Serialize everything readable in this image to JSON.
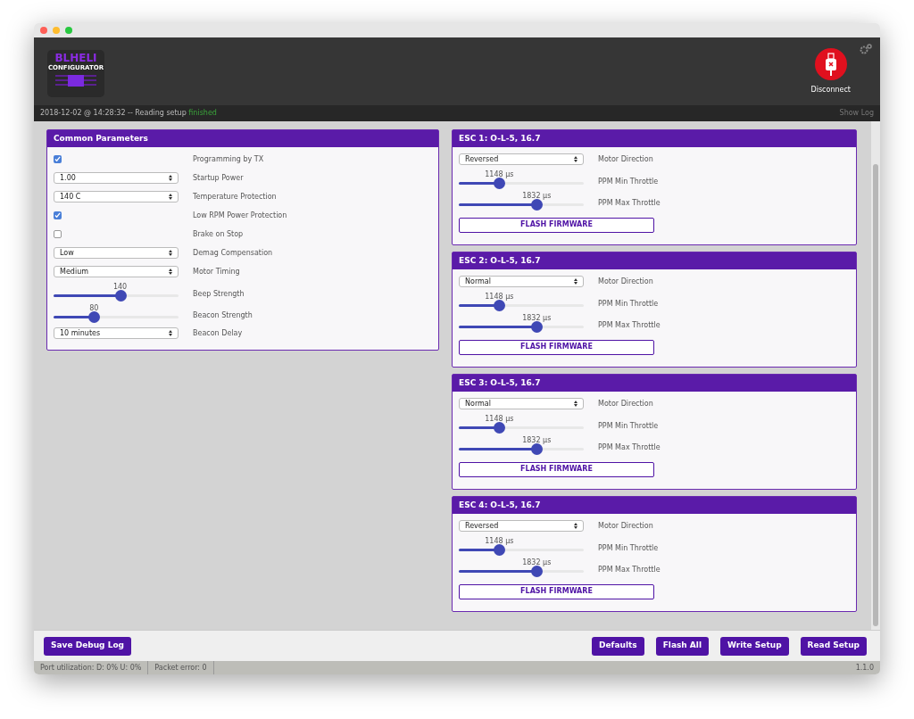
{
  "logo": {
    "line_1": "BLHELI",
    "line_2": "CONFIGURATOR"
  },
  "connection": {
    "label": "Disconnect"
  },
  "log_bar": {
    "message": "2018-12-02 @ 14:28:32 -- Reading setup",
    "status": "finished",
    "show_log": "Show Log"
  },
  "common": {
    "title": "Common Parameters",
    "rows": [
      {
        "kind": "checkbox",
        "label": "Programming by TX",
        "checked": true
      },
      {
        "kind": "select",
        "label": "Startup Power",
        "value": "1.00"
      },
      {
        "kind": "select",
        "label": "Temperature Protection",
        "value": "140 C"
      },
      {
        "kind": "checkbox",
        "label": "Low RPM Power Protection",
        "checked": true
      },
      {
        "kind": "checkbox",
        "label": "Brake on Stop",
        "checked": false
      },
      {
        "kind": "select",
        "label": "Demag Compensation",
        "value": "Low"
      },
      {
        "kind": "select",
        "label": "Motor Timing",
        "value": "Medium"
      },
      {
        "kind": "slider",
        "label": "Beep Strength",
        "reading": "140",
        "level": 0.54
      },
      {
        "kind": "slider",
        "label": "Beacon Strength",
        "reading": "80",
        "level": 0.31
      },
      {
        "kind": "select",
        "label": "Beacon Delay",
        "value": "10 minutes"
      }
    ]
  },
  "escs": [
    {
      "title": "ESC 1: O-L-5, 16.7",
      "rows": [
        {
          "kind": "select",
          "label": "Motor Direction",
          "value": "Reversed"
        },
        {
          "kind": "slider",
          "label": "PPM Min Throttle",
          "reading": "1148 µs",
          "level": 0.31
        },
        {
          "kind": "slider",
          "label": "PPM Max Throttle",
          "reading": "1832 µs",
          "level": 0.64
        }
      ],
      "button": "FLASH FIRMWARE"
    },
    {
      "title": "ESC 2: O-L-5, 16.7",
      "rows": [
        {
          "kind": "select",
          "label": "Motor Direction",
          "value": "Normal"
        },
        {
          "kind": "slider",
          "label": "PPM Min Throttle",
          "reading": "1148 µs",
          "level": 0.31
        },
        {
          "kind": "slider",
          "label": "PPM Max Throttle",
          "reading": "1832 µs",
          "level": 0.64
        }
      ],
      "button": "FLASH FIRMWARE"
    },
    {
      "title": "ESC 3: O-L-5, 16.7",
      "rows": [
        {
          "kind": "select",
          "label": "Motor Direction",
          "value": "Normal"
        },
        {
          "kind": "slider",
          "label": "PPM Min Throttle",
          "reading": "1148 µs",
          "level": 0.31
        },
        {
          "kind": "slider",
          "label": "PPM Max Throttle",
          "reading": "1832 µs",
          "level": 0.64
        }
      ],
      "button": "FLASH FIRMWARE"
    },
    {
      "title": "ESC 4: O-L-5, 16.7",
      "rows": [
        {
          "kind": "select",
          "label": "Motor Direction",
          "value": "Reversed"
        },
        {
          "kind": "slider",
          "label": "PPM Min Throttle",
          "reading": "1148 µs",
          "level": 0.31
        },
        {
          "kind": "slider",
          "label": "PPM Max Throttle",
          "reading": "1832 µs",
          "level": 0.64
        }
      ],
      "button": "FLASH FIRMWARE"
    }
  ],
  "footer": {
    "left_button": "Save Debug Log",
    "right_buttons": [
      "Defaults",
      "Flash All",
      "Write Setup",
      "Read Setup"
    ]
  },
  "status_bar": {
    "port": "Port utilization: D: 0% U: 0%",
    "packet": "Packet error: 0",
    "version": "1.1.0"
  }
}
